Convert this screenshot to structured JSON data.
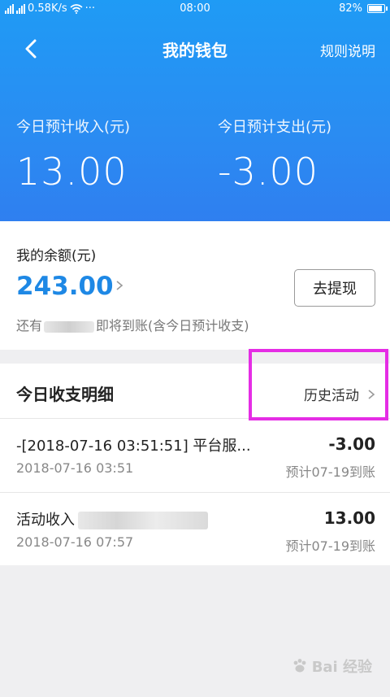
{
  "status_bar": {
    "network_left": "4G",
    "network_right": "2G",
    "speed": "0.58K/s",
    "more": "···",
    "time": "08:00",
    "battery": "82%"
  },
  "nav": {
    "title": "我的钱包",
    "rules": "规则说明"
  },
  "summary": {
    "income_label": "今日预计收入(元)",
    "income_value": "13.00",
    "expense_label": "今日预计支出(元)",
    "expense_value": "-3.00"
  },
  "balance": {
    "label": "我的余额(元)",
    "value": "243.00",
    "withdraw": "去提现",
    "pending_prefix": "还有",
    "pending_suffix": "即将到账(含今日预计收支)"
  },
  "details": {
    "title": "今日收支明细",
    "history": "历史活动",
    "rows": [
      {
        "title": "-[2018-07-16 03:51:51] 平台服...",
        "time": "2018-07-16 03:51",
        "amount": "-3.00",
        "note": "预计07-19到账"
      },
      {
        "title": "活动收入",
        "time": "2018-07-16 07:57",
        "amount": "13.00",
        "note": "预计07-19到账"
      }
    ]
  },
  "watermark": "Bai 经验"
}
